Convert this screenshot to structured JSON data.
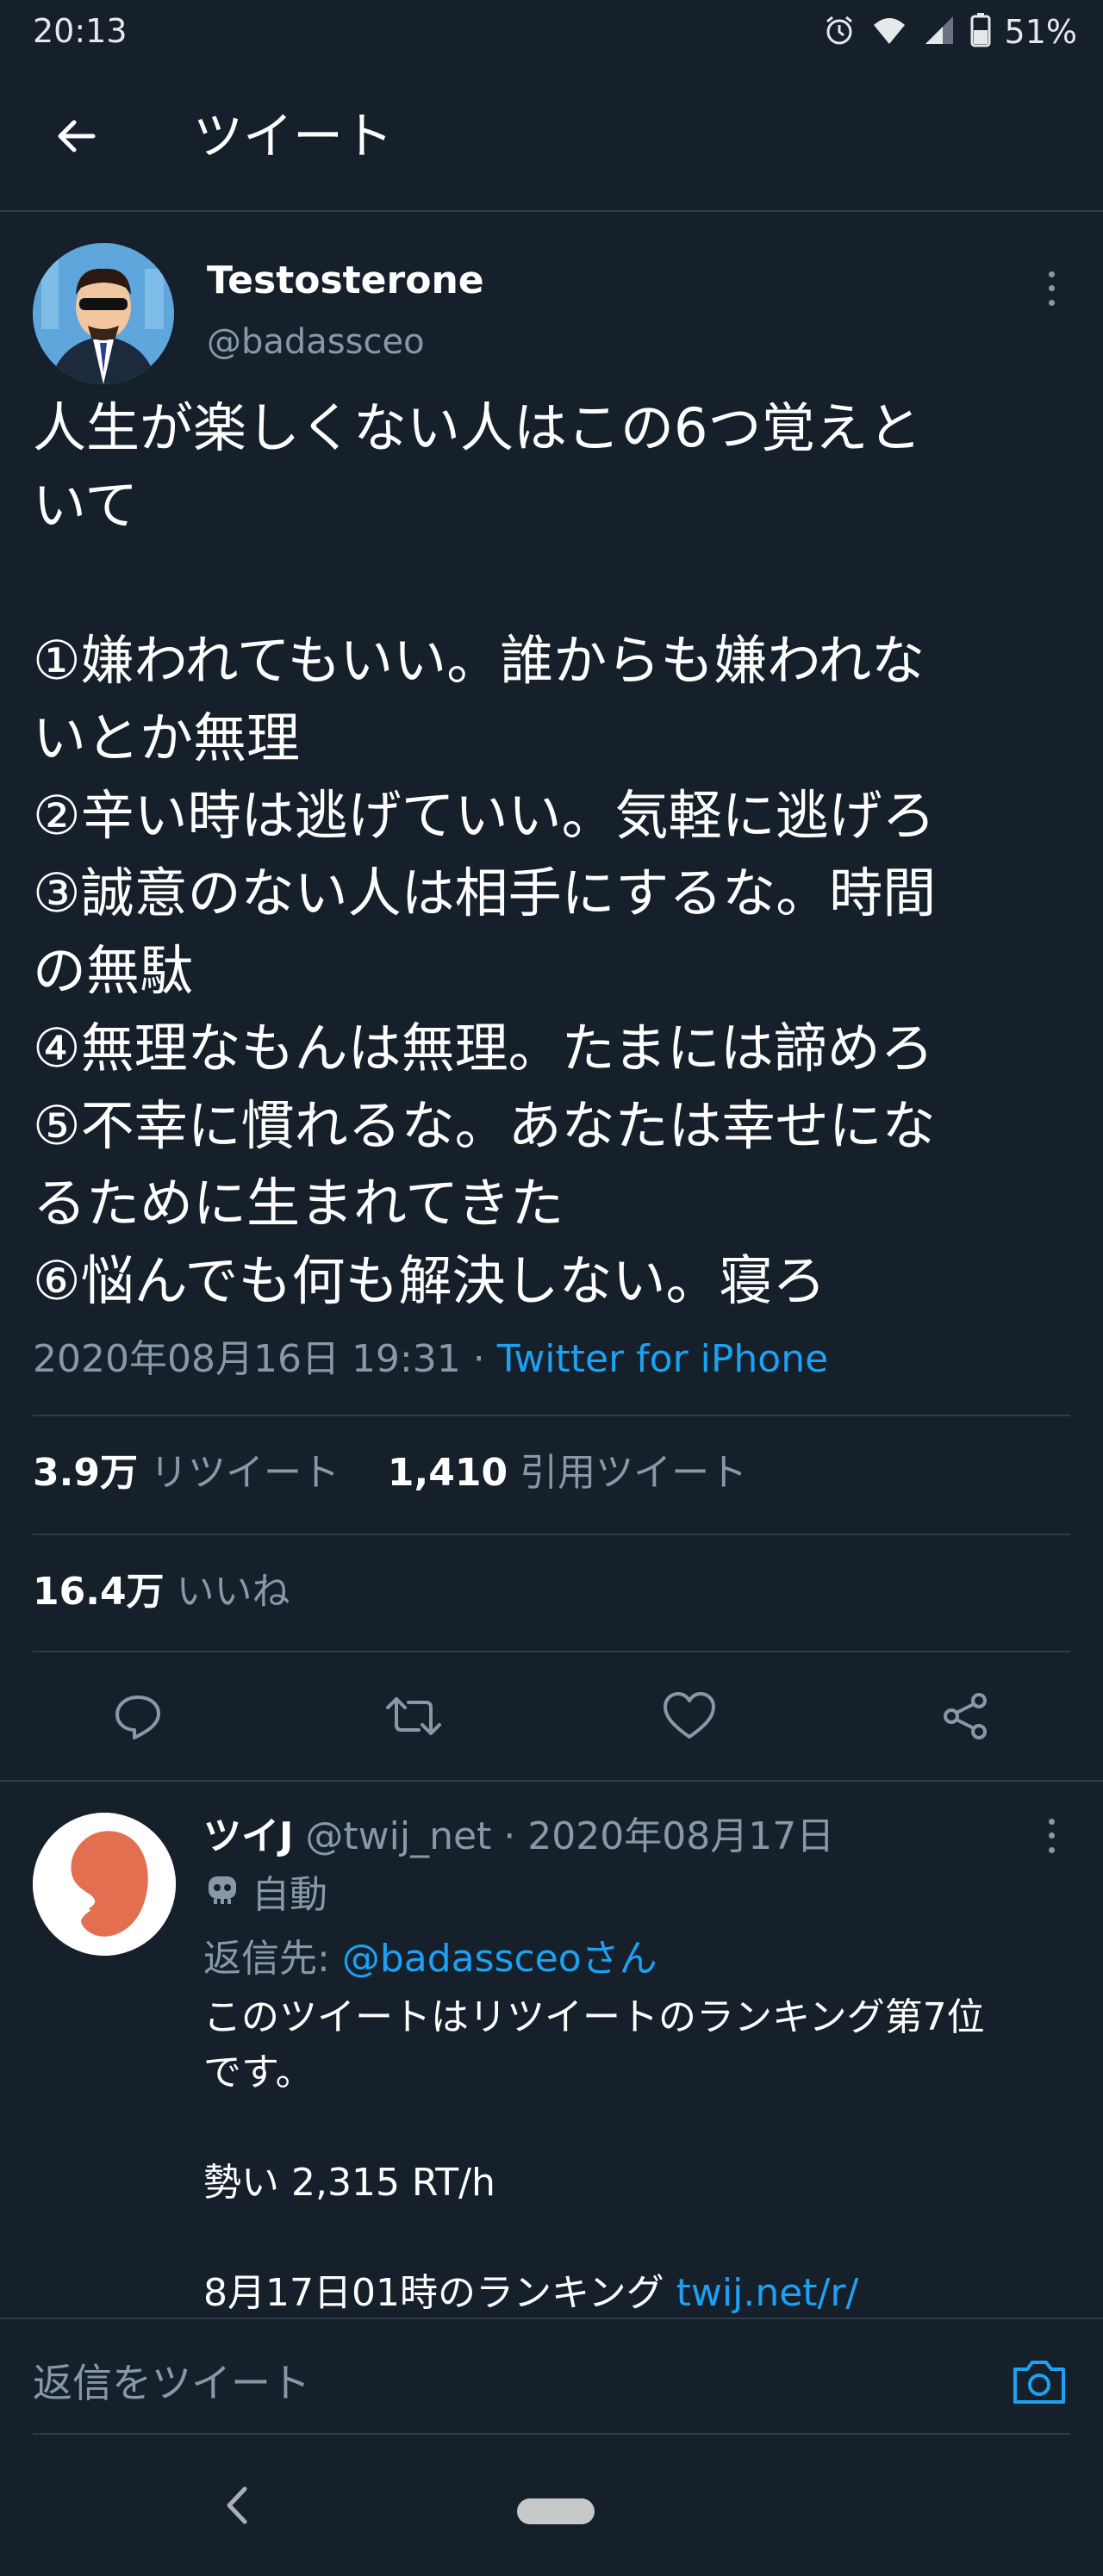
{
  "status_bar": {
    "time": "20:13",
    "battery": "51%",
    "icons": [
      "alarm-icon",
      "wifi-icon",
      "signal-icon",
      "battery-icon"
    ]
  },
  "header": {
    "title": "ツイート",
    "back_icon": "arrow-left-icon"
  },
  "tweet": {
    "author_name": "Testosterone",
    "author_handle": "@badassceo",
    "lines": [
      "人生が楽しくない人はこの6つ覚えと",
      "いて",
      "",
      "①嫌われてもいい。誰からも嫌われな",
      "いとか無理",
      "②辛い時は逃げていい。気軽に逃げろ",
      "③誠意のない人は相手にするな。時間",
      "の無駄",
      "④無理なもんは無理。たまには諦めろ",
      "⑤不幸に慣れるな。あなたは幸せにな",
      "るために生まれてきた",
      "⑥悩んでも何も解決しない。寝ろ"
    ],
    "timestamp": "2020年08月16日 19:31",
    "separator": " · ",
    "source": "Twitter for iPhone",
    "retweets_count": "3.9万",
    "retweets_label": "リツイート",
    "quotes_count": "1,410",
    "quotes_label": "引用ツイート",
    "likes_count": "16.4万",
    "likes_label": "いいね"
  },
  "actions": [
    "reply-icon",
    "retweet-icon",
    "like-icon",
    "share-icon"
  ],
  "reply": {
    "name": "ツイJ",
    "handle": "@twij_net",
    "separator": " · ",
    "date": "2020年08月17日",
    "auto_label": "自動",
    "reply_to_prefix": "返信先: ",
    "reply_to_handle": "@badassceoさん",
    "body_lines": [
      "このツイートはリツイートのランキング第7位",
      "です。",
      "",
      "勢い 2,315 RT/h",
      "",
      "8月17日01時のランキング "
    ],
    "link": "twij.net/r/"
  },
  "composer": {
    "placeholder": "返信をツイート"
  },
  "colors": {
    "background": "#15202b",
    "accent": "#1da1f2",
    "muted": "#8899a6",
    "divider": "#2f3b47"
  }
}
